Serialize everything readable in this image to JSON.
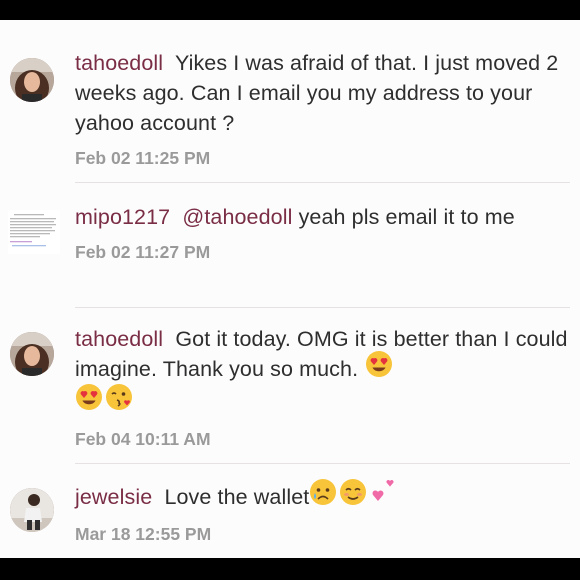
{
  "comments": [
    {
      "username": "tahoedoll",
      "text": "Yikes I was afraid of that. I just moved 2 weeks ago. Can I email you my address to your yahoo account ?",
      "timestamp": "Feb 02 11:25 PM"
    },
    {
      "username": "mipo1217",
      "mention": "@tahoedoll",
      "text": "yeah pls email it to me",
      "timestamp": "Feb 02 11:27 PM"
    },
    {
      "username": "tahoedoll",
      "text": "Got it today. OMG it is better than I could imagine. Thank you so much.",
      "timestamp": "Feb 04 10:11 AM"
    },
    {
      "username": "jewelsie",
      "text": "Love the wallet",
      "timestamp": "Mar 18 12:55 PM"
    }
  ],
  "colors": {
    "username": "#7a2e45",
    "text": "#2e2e2e",
    "timestamp": "#9a9a9a",
    "background": "#fdfcfd"
  }
}
